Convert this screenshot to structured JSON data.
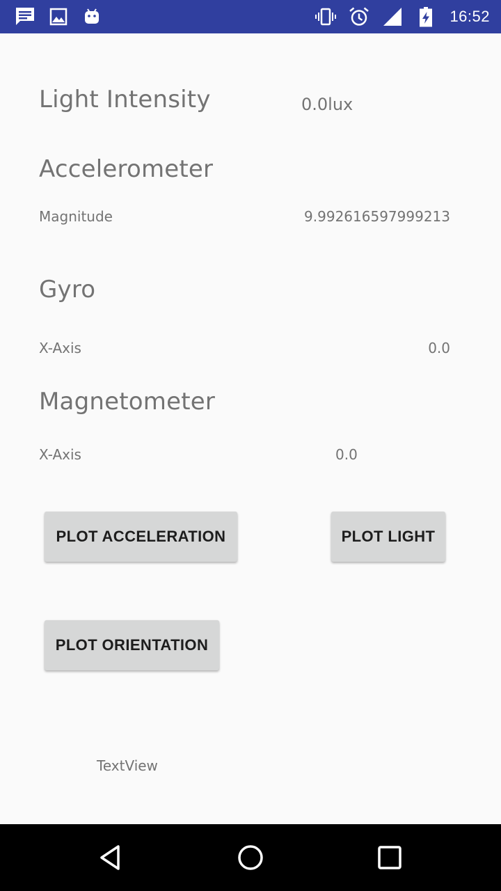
{
  "status_bar": {
    "time": "16:52",
    "bg_color": "#303f9f",
    "left_icons": [
      "message-icon",
      "image-icon",
      "android-icon"
    ],
    "right_icons": [
      "vibrate-icon",
      "alarm-icon",
      "signal-icon",
      "battery-charging-icon"
    ]
  },
  "light": {
    "title": "Light Intensity",
    "value": "0.0lux"
  },
  "accelerometer": {
    "title": "Accelerometer",
    "label": "Magnitude",
    "value": "9.992616597999213"
  },
  "gyro": {
    "title": "Gyro",
    "label": "X-Axis",
    "value": "0.0"
  },
  "magnetometer": {
    "title": "Magnetometer",
    "label": "X-Axis",
    "value": "0.0"
  },
  "buttons": {
    "plot_acceleration": "PLOT ACCELERATION",
    "plot_light": "PLOT LIGHT",
    "plot_orientation": "PLOT ORIENTATION"
  },
  "footer_text": "TextView",
  "nav_bar": {
    "icons": [
      "back-icon",
      "home-icon",
      "recents-icon"
    ]
  }
}
